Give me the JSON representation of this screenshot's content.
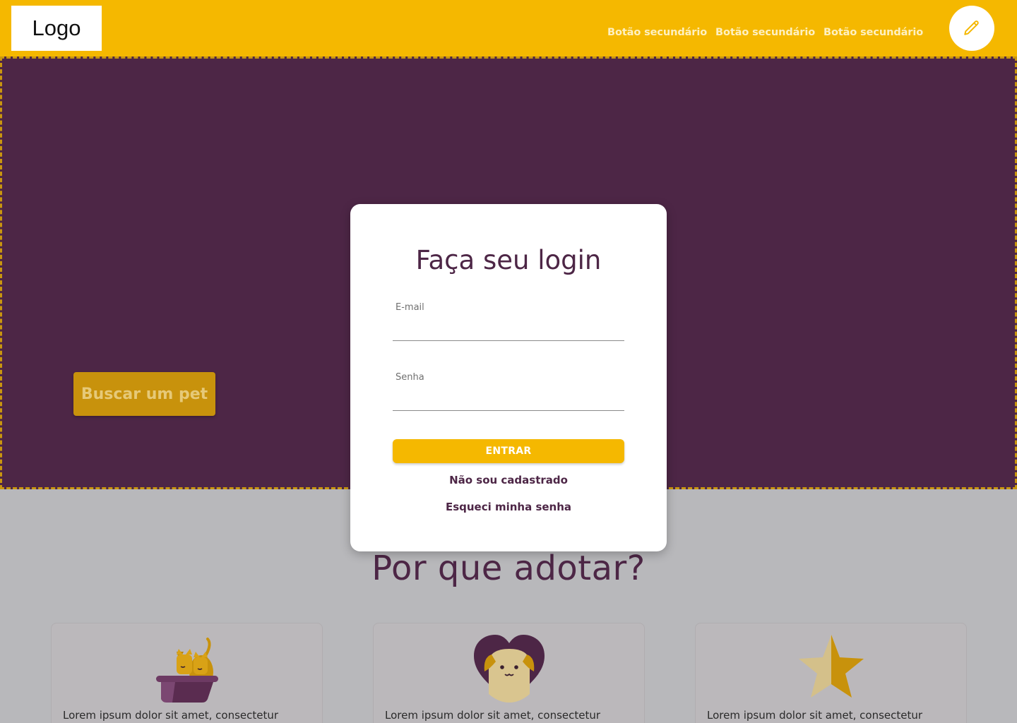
{
  "header": {
    "logo": "Logo",
    "nav": [
      "Botão secundário",
      "Botão secundário",
      "Botão secundário"
    ],
    "action_icon": "pencil-icon"
  },
  "hero": {
    "cta_label": "Buscar um pet"
  },
  "login": {
    "title": "Faça seu login",
    "email_label": "E-mail",
    "email_value": "",
    "password_label": "Senha",
    "password_value": "",
    "submit_label": "ENTRAR",
    "register_link": "Não sou cadastrado",
    "forgot_link": "Esqueci minha senha"
  },
  "why": {
    "title": "Por que adotar?",
    "cards": [
      {
        "icon": "cat-bed-icon",
        "text": "Lorem ipsum dolor sit amet, consectetur"
      },
      {
        "icon": "dog-heart-icon",
        "text": "Lorem ipsum dolor sit amet, consectetur"
      },
      {
        "icon": "star-icon",
        "text": "Lorem ipsum dolor sit amet, consectetur"
      }
    ]
  },
  "colors": {
    "primary_yellow": "#f5b800",
    "primary_purple": "#4d2646",
    "overlay_gray": "#b8b8bb"
  }
}
